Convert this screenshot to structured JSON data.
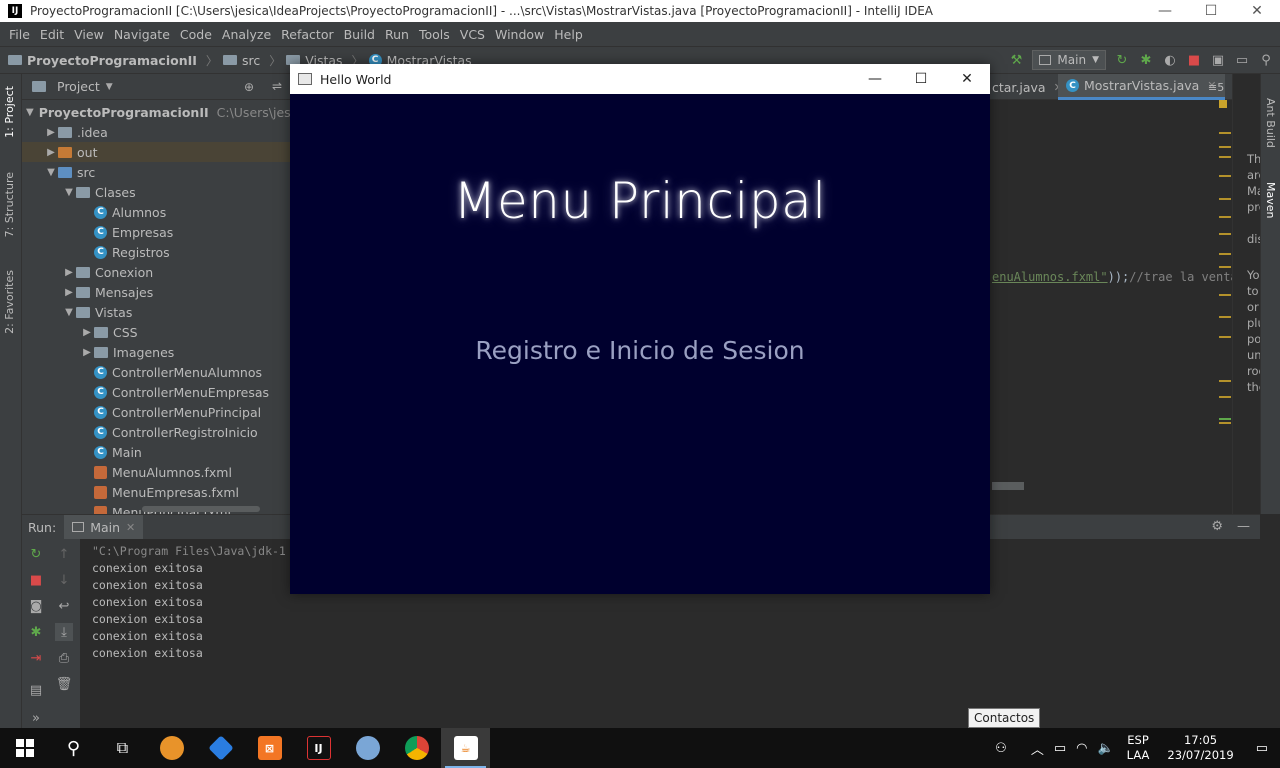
{
  "titlebar": {
    "title": "ProyectoProgramacionII [C:\\Users\\jesica\\IdeaProjects\\ProyectoProgramacionII] - ...\\src\\Vistas\\MostrarVistas.java [ProyectoProgramacionII] - IntelliJ IDEA",
    "app_icon": "IJ"
  },
  "menu": [
    "File",
    "Edit",
    "View",
    "Navigate",
    "Code",
    "Analyze",
    "Refactor",
    "Build",
    "Run",
    "Tools",
    "VCS",
    "Window",
    "Help"
  ],
  "breadcrumb": [
    "ProyectoProgramacionII",
    "src",
    "Vistas",
    "MostrarVistas"
  ],
  "run_config": "Main",
  "left_tabs": [
    "1: Project",
    "7: Structure",
    "2: Favorites"
  ],
  "right_tabs": [
    "Ant Build",
    "Maven"
  ],
  "project_panel": {
    "title": "Project",
    "tree": [
      {
        "label": "ProyectoProgramacionII",
        "path": "C:\\Users\\jesica\\Id",
        "icon": "folder-blue",
        "arrow": "▼",
        "indent": 0,
        "bold": true
      },
      {
        "label": ".idea",
        "icon": "folder",
        "arrow": "▶",
        "indent": 1
      },
      {
        "label": "out",
        "icon": "folder-orange",
        "arrow": "▶",
        "indent": 1,
        "selected": true
      },
      {
        "label": "src",
        "icon": "folder-blue",
        "arrow": "▼",
        "indent": 1
      },
      {
        "label": "Clases",
        "icon": "folder",
        "arrow": "▼",
        "indent": 2
      },
      {
        "label": "Alumnos",
        "icon": "class",
        "arrow": "",
        "indent": 3
      },
      {
        "label": "Empresas",
        "icon": "class",
        "arrow": "",
        "indent": 3
      },
      {
        "label": "Registros",
        "icon": "class",
        "arrow": "",
        "indent": 3
      },
      {
        "label": "Conexion",
        "icon": "folder",
        "arrow": "▶",
        "indent": 2
      },
      {
        "label": "Mensajes",
        "icon": "folder",
        "arrow": "▶",
        "indent": 2
      },
      {
        "label": "Vistas",
        "icon": "folder",
        "arrow": "▼",
        "indent": 2
      },
      {
        "label": "CSS",
        "icon": "folder",
        "arrow": "▶",
        "indent": 3
      },
      {
        "label": "Imagenes",
        "icon": "folder",
        "arrow": "▶",
        "indent": 3
      },
      {
        "label": "ControllerMenuAlumnos",
        "icon": "class",
        "arrow": "",
        "indent": 3
      },
      {
        "label": "ControllerMenuEmpresas",
        "icon": "class",
        "arrow": "",
        "indent": 3
      },
      {
        "label": "ControllerMenuPrincipal",
        "icon": "class",
        "arrow": "",
        "indent": 3
      },
      {
        "label": "ControllerRegistroInicio",
        "icon": "class",
        "arrow": "",
        "indent": 3
      },
      {
        "label": "Main",
        "icon": "class",
        "arrow": "",
        "indent": 3
      },
      {
        "label": "MenuAlumnos.fxml",
        "icon": "fxml",
        "arrow": "",
        "indent": 3
      },
      {
        "label": "MenuEmpresas.fxml",
        "icon": "fxml",
        "arrow": "",
        "indent": 3
      },
      {
        "label": "MenuPrincipal.fxml",
        "icon": "fxml",
        "arrow": "",
        "indent": 3
      }
    ]
  },
  "editor": {
    "tabs": [
      "ctar.java",
      "MostrarVistas.java"
    ],
    "tab_overflow": "≡5",
    "code_string": "enuAlumnos.fxml\"",
    "code_rest": "));",
    "code_comment": "//trae la ventan"
  },
  "doc_panel": [
    "Th",
    "are",
    "Ma",
    "pro",
    "dis",
    "You",
    "to",
    "or",
    "plu",
    "por",
    "unc",
    "roc",
    "the"
  ],
  "run_panel": {
    "label": "Run:",
    "tab": "Main",
    "command": "\"C:\\Program Files\\Java\\jdk-1",
    "output": [
      "conexion exitosa",
      "conexion exitosa",
      "conexion exitosa",
      "conexion exitosa",
      "conexion exitosa",
      "conexion exitosa"
    ]
  },
  "hello_window": {
    "title": "Hello World",
    "heading": "Menu Principal",
    "link": "Registro e Inicio de Sesion",
    "background": "#00002e"
  },
  "tooltip": "Contactos",
  "taskbar": {
    "lang_top": "ESP",
    "lang_bottom": "LAA",
    "time": "17:05",
    "date": "23/07/2019"
  }
}
